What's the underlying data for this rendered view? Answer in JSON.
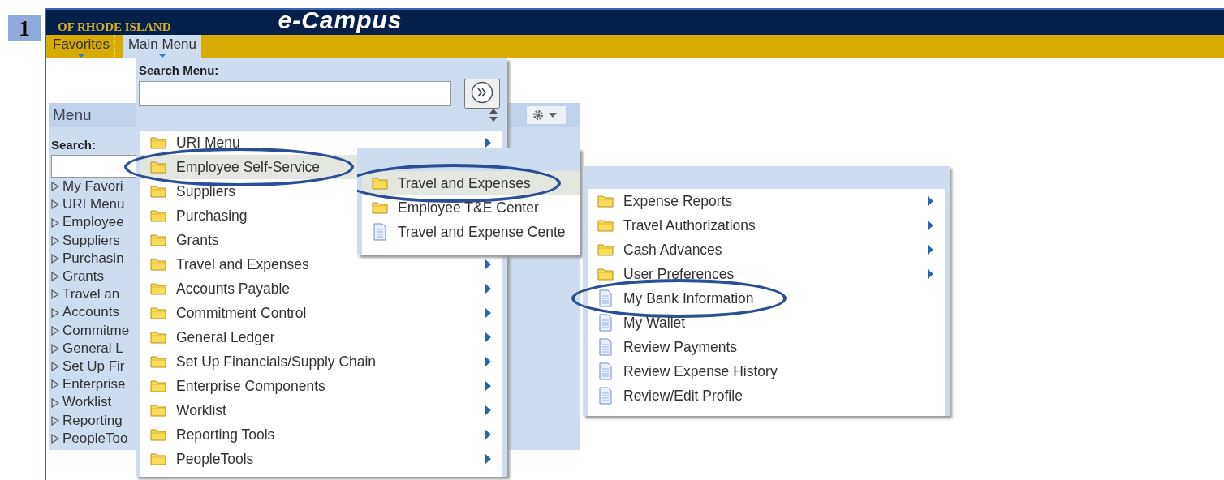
{
  "step_number": "1",
  "header": {
    "logo_text": "OF RHODE ISLAND",
    "title": "e-Campus"
  },
  "nav_tabs": [
    {
      "label": "Favorites",
      "selected": false
    },
    {
      "label": "Main Menu",
      "selected": true
    }
  ],
  "menu_panel": {
    "title": "Menu",
    "search_label": "Search:",
    "items": [
      "My Favori",
      "URI Menu",
      "Employee",
      "Suppliers",
      "Purchasin",
      "Grants",
      "Travel an",
      "Accounts",
      "Commitme",
      "General L",
      "Set Up Fir",
      "Enterprise",
      "Worklist",
      "Reporting",
      "PeopleToo"
    ]
  },
  "main_menu": {
    "search_label": "Search Menu:",
    "items": [
      {
        "label": "URI Menu",
        "kind": "folder",
        "arrow": true,
        "selected": false,
        "circled": false
      },
      {
        "label": "Employee Self-Service",
        "kind": "folder",
        "arrow": false,
        "selected": true,
        "circled": true
      },
      {
        "label": "Suppliers",
        "kind": "folder",
        "arrow": false,
        "selected": false,
        "circled": false
      },
      {
        "label": "Purchasing",
        "kind": "folder",
        "arrow": false,
        "selected": false,
        "circled": false
      },
      {
        "label": "Grants",
        "kind": "folder",
        "arrow": false,
        "selected": false,
        "circled": false
      },
      {
        "label": "Travel and Expenses",
        "kind": "folder",
        "arrow": true,
        "selected": false,
        "circled": false
      },
      {
        "label": "Accounts Payable",
        "kind": "folder",
        "arrow": true,
        "selected": false,
        "circled": false
      },
      {
        "label": "Commitment Control",
        "kind": "folder",
        "arrow": true,
        "selected": false,
        "circled": false
      },
      {
        "label": "General Ledger",
        "kind": "folder",
        "arrow": true,
        "selected": false,
        "circled": false
      },
      {
        "label": "Set Up Financials/Supply Chain",
        "kind": "folder",
        "arrow": true,
        "selected": false,
        "circled": false
      },
      {
        "label": "Enterprise Components",
        "kind": "folder",
        "arrow": true,
        "selected": false,
        "circled": false
      },
      {
        "label": "Worklist",
        "kind": "folder",
        "arrow": true,
        "selected": false,
        "circled": false
      },
      {
        "label": "Reporting Tools",
        "kind": "folder",
        "arrow": true,
        "selected": false,
        "circled": false
      },
      {
        "label": "PeopleTools",
        "kind": "folder",
        "arrow": true,
        "selected": false,
        "circled": false
      }
    ]
  },
  "submenu_1": {
    "items": [
      {
        "label": "Travel and Expenses",
        "kind": "folder",
        "arrow": false,
        "selected": true,
        "circled": true
      },
      {
        "label": "Employee T&E Center",
        "kind": "folder",
        "arrow": false,
        "selected": false,
        "circled": false
      },
      {
        "label": "Travel and Expense Cente",
        "kind": "page",
        "arrow": false,
        "selected": false,
        "circled": false
      }
    ]
  },
  "submenu_2": {
    "items": [
      {
        "label": "Expense Reports",
        "kind": "folder",
        "arrow": true,
        "selected": false,
        "circled": false
      },
      {
        "label": "Travel Authorizations",
        "kind": "folder",
        "arrow": true,
        "selected": false,
        "circled": false
      },
      {
        "label": "Cash Advances",
        "kind": "folder",
        "arrow": true,
        "selected": false,
        "circled": false
      },
      {
        "label": "User Preferences",
        "kind": "folder",
        "arrow": true,
        "selected": false,
        "circled": false
      },
      {
        "label": "My Bank Information",
        "kind": "page",
        "arrow": false,
        "selected": false,
        "circled": true
      },
      {
        "label": "My Wallet",
        "kind": "page",
        "arrow": false,
        "selected": false,
        "circled": false
      },
      {
        "label": "Review Payments",
        "kind": "page",
        "arrow": false,
        "selected": false,
        "circled": false
      },
      {
        "label": "Review Expense History",
        "kind": "page",
        "arrow": false,
        "selected": false,
        "circled": false
      },
      {
        "label": "Review/Edit Profile",
        "kind": "page",
        "arrow": false,
        "selected": false,
        "circled": false
      }
    ]
  }
}
